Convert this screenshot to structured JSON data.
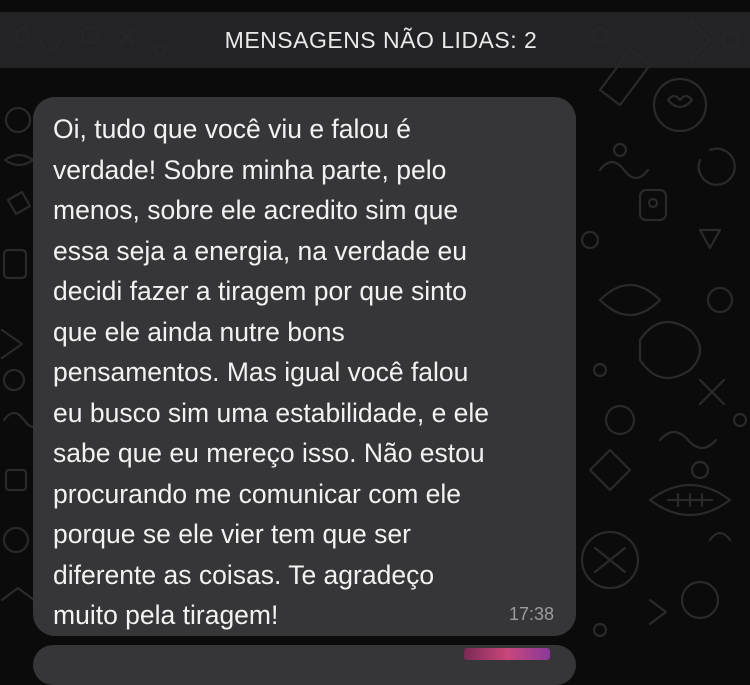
{
  "colors": {
    "background": "#0b0b0b",
    "bubble": "#363638",
    "bubble_text": "#f2f2f2",
    "timestamp": "#9c9ca0",
    "unread_bar": "#262628"
  },
  "unread_banner": {
    "label": "MENSAGENS NÃO LIDAS: 2"
  },
  "message": {
    "text": "Oi, tudo que você viu e falou é\nverdade! Sobre minha parte, pelo\nmenos, sobre ele acredito sim que\nessa seja a energia, na verdade eu\ndecidi fazer a tiragem por que sinto\nque ele ainda nutre bons\npensamentos. Mas igual você falou\neu busco sim uma estabilidade, e ele\nsabe que eu mereço isso. Não estou\nprocurando me comunicar com ele\nporque se ele vier tem que ser\ndiferente as coisas. Te agradeço\nmuito pela tiragem!",
    "time": "17:38"
  }
}
